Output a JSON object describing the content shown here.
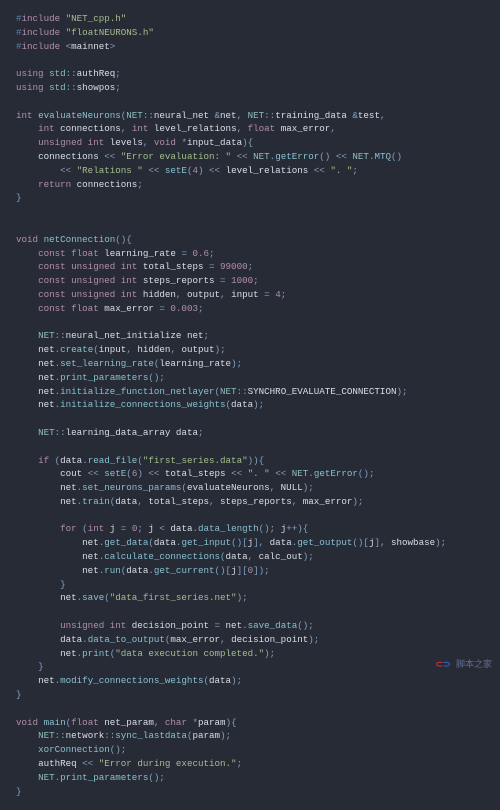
{
  "code": {
    "lines": [
      {
        "t": "inc",
        "v": "#include \"NET_cpp.h\""
      },
      {
        "t": "inc",
        "v": "#include \"floatNEURONS.h\""
      },
      {
        "t": "inc2",
        "v": "#include <mainnet>"
      },
      {
        "t": "blank",
        "v": ""
      },
      {
        "t": "using",
        "v": "using std::authReq;"
      },
      {
        "t": "using",
        "v": "using std::showpos;"
      },
      {
        "t": "blank",
        "v": ""
      },
      {
        "t": "sig1",
        "v": "int evaluateNeurons(NET::neural_net &net, NET::training_data &test,"
      },
      {
        "t": "sig2",
        "v": "    int connections, int level_relations, float max_error,"
      },
      {
        "t": "sig3",
        "v": "    unsigned int levels, void *input_data){"
      },
      {
        "t": "b1",
        "v": "    connections << \"Error evaluation: \" << NET.getError() << NET.MTQ()"
      },
      {
        "t": "b2",
        "v": "        << \"Relations \" << setE(4) << level_relations << \". \";"
      },
      {
        "t": "ret",
        "v": "    return connections;"
      },
      {
        "t": "close",
        "v": "}"
      },
      {
        "t": "blank",
        "v": ""
      },
      {
        "t": "blank",
        "v": ""
      },
      {
        "t": "fn2",
        "v": "void netConnection(){"
      },
      {
        "t": "c1",
        "v": "    const float learning_rate = 0.6;"
      },
      {
        "t": "c2",
        "v": "    const unsigned int total_steps = 99000;"
      },
      {
        "t": "c3",
        "v": "    const unsigned int steps_reports = 1000;"
      },
      {
        "t": "c4",
        "v": "    const unsigned int hidden, output, input = 4;"
      },
      {
        "t": "c5",
        "v": "    const float max_error = 0.003;"
      },
      {
        "t": "blank",
        "v": ""
      },
      {
        "t": "n1",
        "v": "    NET::neural_net_initialize net;"
      },
      {
        "t": "n2",
        "v": "    net.create(input, hidden, output);"
      },
      {
        "t": "n3",
        "v": "    net.set_learning_rate(learning_rate);"
      },
      {
        "t": "n4",
        "v": "    net.print_parameters();"
      },
      {
        "t": "n5",
        "v": "    net.initialize_function_netlayer(NET::SYNCHRO_EVALUATE_CONNECTION);"
      },
      {
        "t": "n6",
        "v": "    net.initialize_connections_weights(data);"
      },
      {
        "t": "blank",
        "v": ""
      },
      {
        "t": "d1",
        "v": "    NET::learning_data_array data;"
      },
      {
        "t": "blank",
        "v": ""
      },
      {
        "t": "if1",
        "v": "    if (data.read_file(\"first_series.data\")){"
      },
      {
        "t": "if2",
        "v": "        cout << setE(6) << total_steps << \". \" << NET.getError();"
      },
      {
        "t": "if3",
        "v": "        net.set_neurons_params(evaluateNeurons, NULL);"
      },
      {
        "t": "if4",
        "v": "        net.train(data, total_steps, steps_reports, max_error);"
      },
      {
        "t": "blank",
        "v": ""
      },
      {
        "t": "for1",
        "v": "        for (int j = 0; j < data.data_length(); j++){"
      },
      {
        "t": "for2",
        "v": "            net.get_data(data.get_input()[j], data.get_output()[j], showbase);"
      },
      {
        "t": "for3",
        "v": "            net.calculate_connections(data, calc_out);"
      },
      {
        "t": "for4",
        "v": "            net.run(data.get_current()[j][0]);"
      },
      {
        "t": "forc",
        "v": "        }"
      },
      {
        "t": "sv1",
        "v": "        net.save(\"data_first_series.net\");"
      },
      {
        "t": "blank",
        "v": ""
      },
      {
        "t": "dp1",
        "v": "        unsigned int decision_point = net.save_data();"
      },
      {
        "t": "dp2",
        "v": "        data.data_to_output(max_error, decision_point);"
      },
      {
        "t": "dp3",
        "v": "        net.print(\"data execution completed.\");"
      },
      {
        "t": "ifc",
        "v": "    }"
      },
      {
        "t": "m1",
        "v": "    net.modify_connections_weights(data);"
      },
      {
        "t": "close",
        "v": "}"
      },
      {
        "t": "blank",
        "v": ""
      },
      {
        "t": "mn1",
        "v": "void main(float net_param, char *param){"
      },
      {
        "t": "mn2",
        "v": "    NET::network::sync_lastdata(param);"
      },
      {
        "t": "mn3",
        "v": "    xorConnection();"
      },
      {
        "t": "mn4",
        "v": "    authReq << \"Error during execution.\";"
      },
      {
        "t": "mn5",
        "v": "    NET.print_parameters();"
      },
      {
        "t": "close",
        "v": "}"
      }
    ]
  }
}
